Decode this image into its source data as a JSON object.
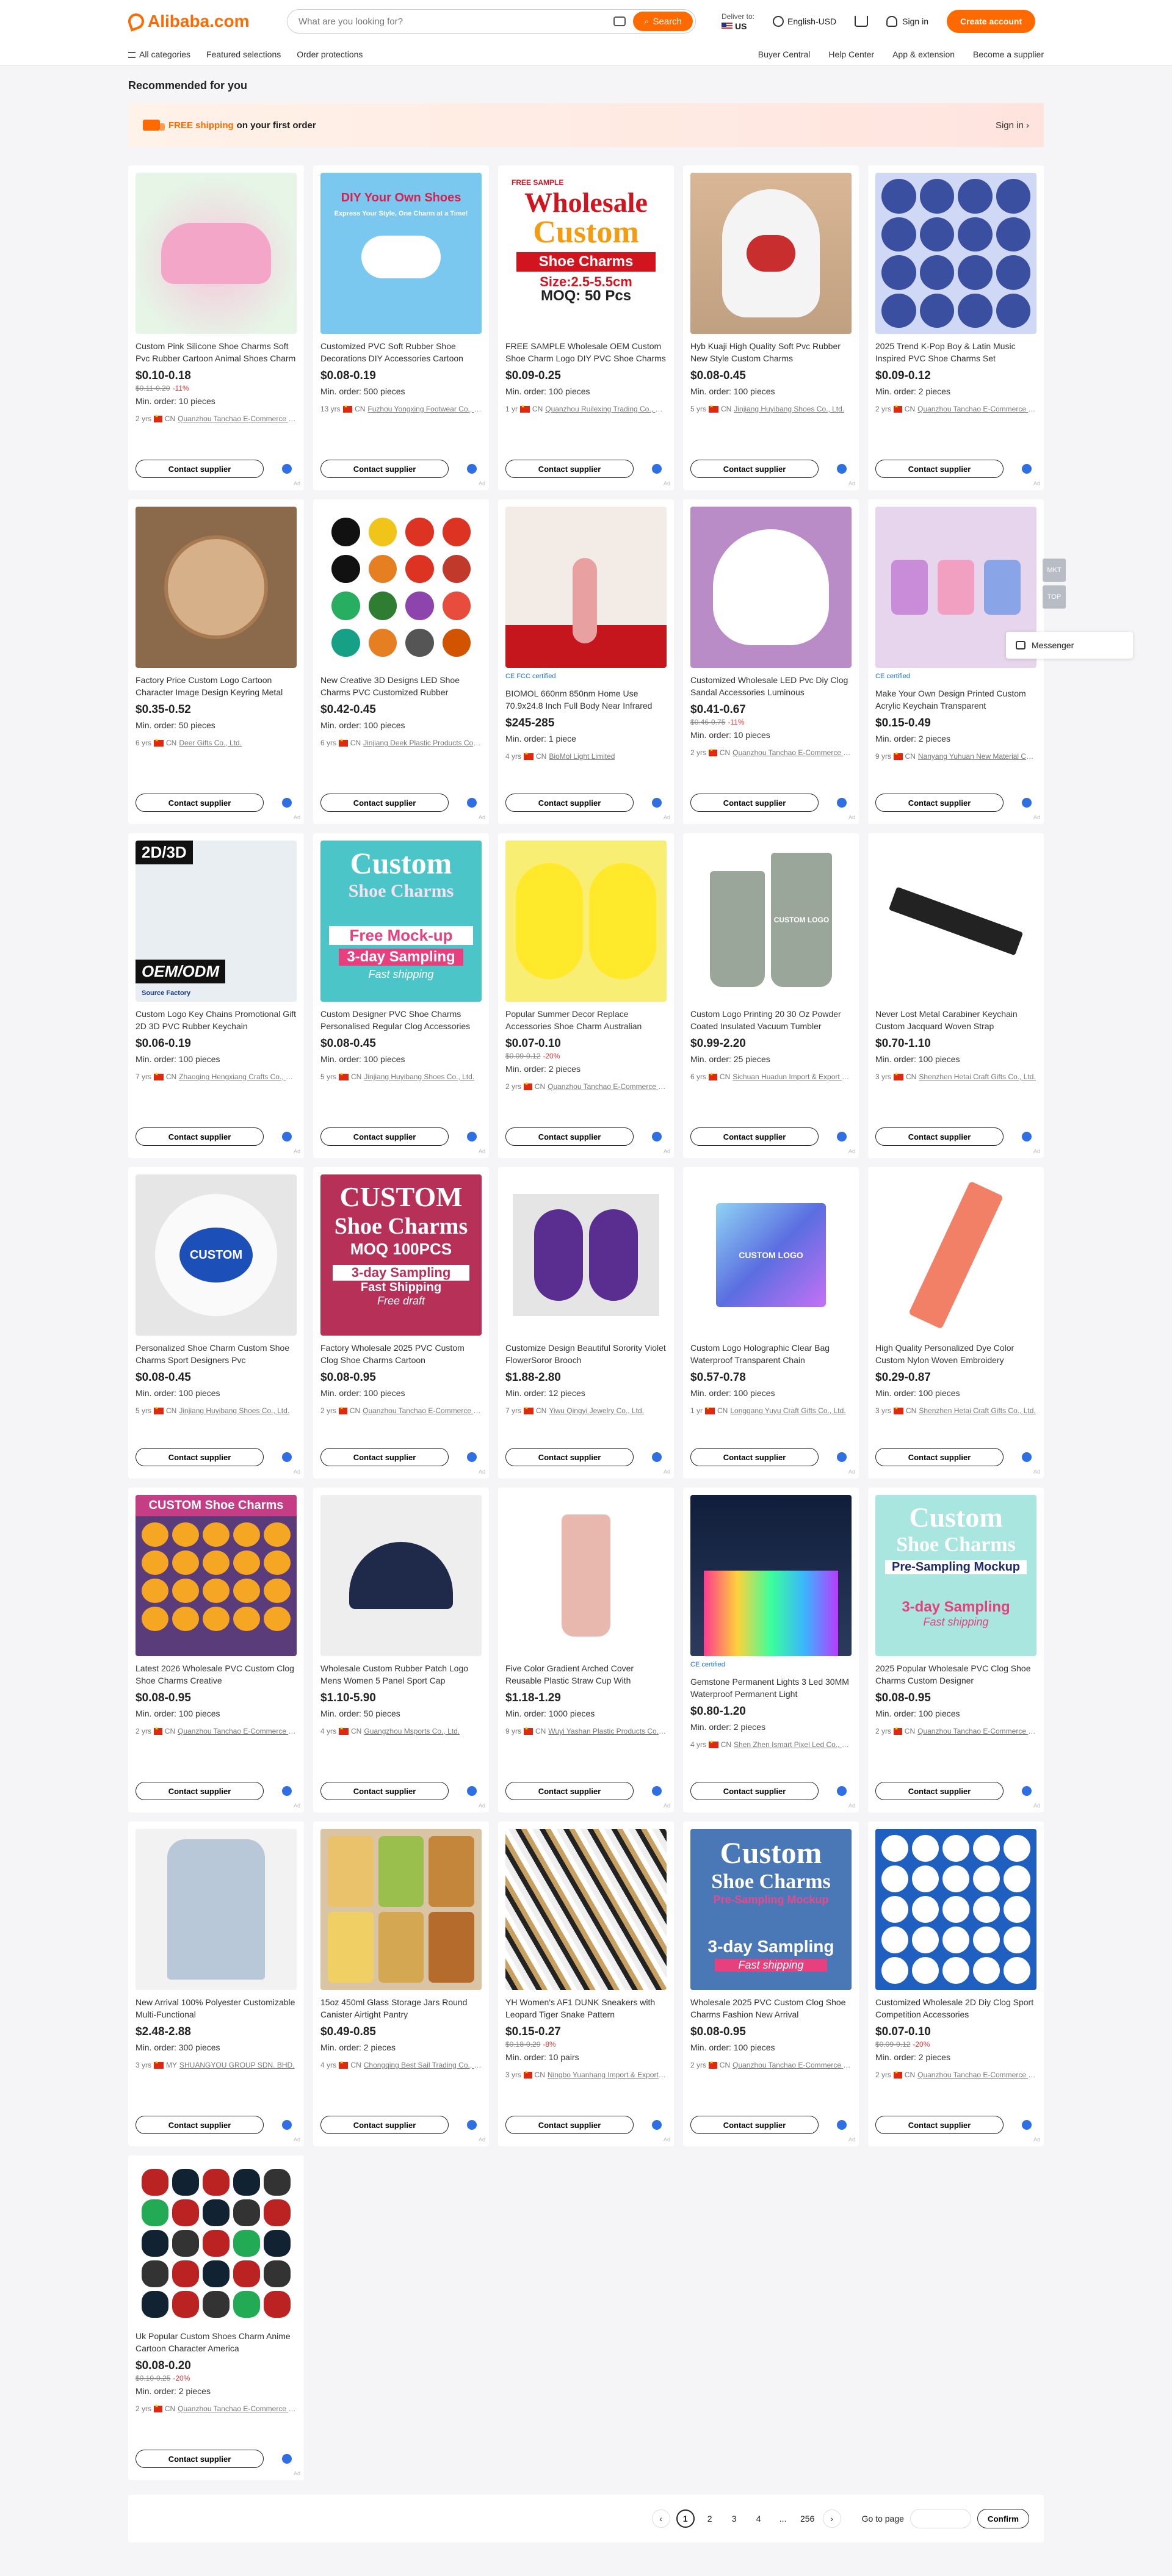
{
  "header": {
    "logo": "Alibaba.com",
    "search_placeholder": "What are you looking for?",
    "search_button": "Search",
    "deliver_label": "Deliver to:",
    "deliver_value": "US",
    "language": "English-USD",
    "sign_in": "Sign in",
    "create_account": "Create account"
  },
  "nav": {
    "left": [
      "All categories",
      "Featured selections",
      "Order protections"
    ],
    "right": [
      "Buyer Central",
      "Help Center",
      "App & extension",
      "Become a supplier"
    ]
  },
  "section_title": "Recommended for you",
  "promo": {
    "free": "FREE shipping",
    "rest": "on your first order",
    "sign_in": "Sign in ›"
  },
  "side_tools": [
    "MKT",
    "TOP"
  ],
  "messenger": "Messenger",
  "contact_label": "Contact supplier",
  "products": [
    {
      "title": "Custom Pink Silicone Shoe Charms Soft Pvc Rubber Cartoon Animal Shoes Charm",
      "price": "$0.10-0.18",
      "orig": "$0.11-0.20",
      "disc": "-11%",
      "moq": "Min. order: 10 pieces",
      "yrs": "2 yrs",
      "country": "CN",
      "supplier": "Quanzhou Tanchao E-Commerce Co., Ltd.",
      "cert": "",
      "art": "pink"
    },
    {
      "title": "Customized PVC Soft Rubber Shoe Decorations DIY Accessories Cartoon",
      "price": "$0.08-0.19",
      "orig": "",
      "disc": "",
      "moq": "Min. order: 500 pieces",
      "yrs": "13 yrs",
      "country": "CN",
      "supplier": "Fuzhou Yongxing Footwear Co., Ltd.",
      "cert": "",
      "art": "diy",
      "art_text": "DIY Your Own Shoes",
      "art_sub": "Express Your Style, One Charm at a Time!"
    },
    {
      "title": "FREE SAMPLE Wholesale OEM Custom Shoe Charm Logo DIY PVC Shoe Charms",
      "price": "$0.09-0.25",
      "orig": "",
      "disc": "",
      "moq": "Min. order: 100 pieces",
      "yrs": "1 yr",
      "country": "CN",
      "supplier": "Quanzhou Ruilexing Trading Co., Ltd.",
      "cert": "",
      "art": "wholesale",
      "art_lines": [
        "FREE SAMPLE",
        "Wholesale",
        "Custom",
        "Shoe Charms",
        "Size:2.5-5.5cm",
        "MOQ: 50 Pcs"
      ]
    },
    {
      "title": "Hyb Kuaji High Quality Soft Pvc Rubber New Style Custom Charms",
      "price": "$0.08-0.45",
      "orig": "",
      "disc": "",
      "moq": "Min. order: 100 pieces",
      "yrs": "5 yrs",
      "country": "CN",
      "supplier": "Jinjiang Huyibang Shoes Co., Ltd.",
      "cert": "",
      "art": "clog-white"
    },
    {
      "title": "2025 Trend K-Pop Boy & Latin Music Inspired PVC Shoe Charms Set",
      "price": "$0.09-0.12",
      "orig": "",
      "disc": "",
      "moq": "Min. order: 2 pieces",
      "yrs": "2 yrs",
      "country": "CN",
      "supplier": "Quanzhou Tanchao E-Commerce Co., Ltd.",
      "cert": "",
      "art": "kpop"
    },
    {
      "title": "Factory Price Custom Logo Cartoon Character Image Design Keyring Metal",
      "price": "$0.35-0.52",
      "orig": "",
      "disc": "",
      "moq": "Min. order: 50 pieces",
      "yrs": "6 yrs",
      "country": "CN",
      "supplier": "Deer Gifts Co., Ltd.",
      "cert": "",
      "art": "keyring"
    },
    {
      "title": "New Creative 3D Designs LED Shoe Charms PVC Customized Rubber",
      "price": "$0.42-0.45",
      "orig": "",
      "disc": "",
      "moq": "Min. order: 100 pieces",
      "yrs": "6 yrs",
      "country": "CN",
      "supplier": "Jinjiang Deek Plastic Products Co., Ltd.",
      "cert": "",
      "art": "grid-charms"
    },
    {
      "title": "BIOMOL 660nm 850nm Home Use 70.9x24.8 Inch Full Body Near Infrared",
      "price": "$245-285",
      "orig": "",
      "disc": "",
      "moq": "Min. order: 1 piece",
      "yrs": "4 yrs",
      "country": "CN",
      "supplier": "BioMol Light Limited",
      "cert": "CE FCC certified",
      "art": "yoga"
    },
    {
      "title": "Customized Wholesale LED Pvc Diy Clog Sandal Accessories Luminous",
      "price": "$0.41-0.67",
      "orig": "$0.46-0.75",
      "disc": "-11%",
      "moq": "Min. order: 10 pieces",
      "yrs": "2 yrs",
      "country": "CN",
      "supplier": "Quanzhou Tanchao E-Commerce Co., Ltd.",
      "cert": "",
      "art": "clog-pink"
    },
    {
      "title": "Make Your Own Design Printed Custom Acrylic Keychain Transparent",
      "price": "$0.15-0.49",
      "orig": "",
      "disc": "",
      "moq": "Min. order: 2 pieces",
      "yrs": "9 yrs",
      "country": "CN",
      "supplier": "Nanyang Yuhuan New Material Co., Ltd.",
      "cert": "CE certified",
      "art": "acrylic"
    },
    {
      "title": "Custom Logo Key Chains Promotional Gift 2D 3D PVC Rubber Keychain",
      "price": "$0.06-0.19",
      "orig": "",
      "disc": "",
      "moq": "Min. order: 100 pieces",
      "yrs": "7 yrs",
      "country": "CN",
      "supplier": "Zhaoqing Hengxiang Crafts Co., Ltd.",
      "cert": "",
      "art": "oem",
      "art_lines": [
        "2D/3D",
        "OEM/ODM",
        "Source Factory"
      ]
    },
    {
      "title": "Custom Designer PVC Shoe Charms Personalised Regular Clog Accessories",
      "price": "$0.08-0.45",
      "orig": "",
      "disc": "",
      "moq": "Min. order: 100 pieces",
      "yrs": "5 yrs",
      "country": "CN",
      "supplier": "Jinjiang Huyibang Shoes Co., Ltd.",
      "cert": "",
      "art": "custom-teal",
      "art_lines": [
        "Custom",
        "Shoe Charms",
        "Free Mock-up",
        "3-day Sampling",
        "Fast shipping"
      ]
    },
    {
      "title": "Popular Summer Decor Replace Accessories Shoe Charm Australian Animal",
      "price": "$0.07-0.10",
      "orig": "$0.09-0.12",
      "disc": "-20%",
      "moq": "Min. order: 2 pieces",
      "yrs": "2 yrs",
      "country": "CN",
      "supplier": "Quanzhou Tanchao E-Commerce Co., Ltd.",
      "cert": "",
      "art": "clog-yellow"
    },
    {
      "title": "Custom Logo Printing 20 30 Oz Powder Coated Insulated Vacuum Tumbler",
      "price": "$0.99-2.20",
      "orig": "",
      "disc": "",
      "moq": "Min. order: 25 pieces",
      "yrs": "6 yrs",
      "country": "CN",
      "supplier": "Sichuan Huadun Import & Export Co., Ltd.",
      "cert": "",
      "art": "tumbler",
      "art_text": "CUSTOM LOGO"
    },
    {
      "title": "Never Lost Metal Carabiner Keychain Custom Jacquard Woven Strap",
      "price": "$0.70-1.10",
      "orig": "",
      "disc": "",
      "moq": "Min. order: 100 pieces",
      "yrs": "3 yrs",
      "country": "CN",
      "supplier": "Shenzhen Hetai Craft Gifts Co., Ltd.",
      "cert": "",
      "art": "strap"
    },
    {
      "title": "Personalized Shoe Charm Custom Shoe Charms Sport Designers Pvc",
      "price": "$0.08-0.45",
      "orig": "",
      "disc": "",
      "moq": "Min. order: 100 pieces",
      "yrs": "5 yrs",
      "country": "CN",
      "supplier": "Jinjiang Huyibang Shoes Co., Ltd.",
      "cert": "",
      "art": "clog-blue",
      "art_text": "CUSTOM"
    },
    {
      "title": "Factory Wholesale 2025 PVC Custom Clog Shoe Charms Cartoon",
      "price": "$0.08-0.95",
      "orig": "",
      "disc": "",
      "moq": "Min. order: 100 pieces",
      "yrs": "2 yrs",
      "country": "CN",
      "supplier": "Quanzhou Tanchao E-Commerce Co., Ltd.",
      "cert": "",
      "art": "custom-pink",
      "art_lines": [
        "CUSTOM",
        "Shoe Charms",
        "MOQ 100PCS",
        "3-day Sampling",
        "Fast Shipping",
        "Free draft"
      ]
    },
    {
      "title": "Customize Design Beautiful Sorority Violet FlowerSoror Brooch",
      "price": "$1.88-2.80",
      "orig": "",
      "disc": "",
      "moq": "Min. order: 12 pieces",
      "yrs": "7 yrs",
      "country": "CN",
      "supplier": "Yiwu Qingyi Jewelry Co., Ltd.",
      "cert": "",
      "art": "brooch"
    },
    {
      "title": "Custom Logo Holographic Clear Bag Waterproof Transparent Chain",
      "price": "$0.57-0.78",
      "orig": "",
      "disc": "",
      "moq": "Min. order: 100 pieces",
      "yrs": "1 yr",
      "country": "CN",
      "supplier": "Longgang Yuyu Craft Gifts Co., Ltd.",
      "cert": "",
      "art": "bag",
      "art_text": "CUSTOM LOGO"
    },
    {
      "title": "High Quality Personalized Dye Color Custom Nylon Woven Embroidery",
      "price": "$0.29-0.87",
      "orig": "",
      "disc": "",
      "moq": "Min. order: 100 pieces",
      "yrs": "3 yrs",
      "country": "CN",
      "supplier": "Shenzhen Hetai Craft Gifts Co., Ltd.",
      "cert": "",
      "art": "lanyard"
    },
    {
      "title": "Latest 2026 Wholesale PVC Custom Clog Shoe Charms Creative",
      "price": "$0.08-0.95",
      "orig": "",
      "disc": "",
      "moq": "Min. order: 100 pieces",
      "yrs": "2 yrs",
      "country": "CN",
      "supplier": "Quanzhou Tanchao E-Commerce Co., Ltd.",
      "cert": "",
      "art": "charm-collage",
      "art_text": "CUSTOM Shoe Charms"
    },
    {
      "title": "Wholesale Custom Rubber Patch Logo Mens Women 5 Panel Sport Cap",
      "price": "$1.10-5.90",
      "orig": "",
      "disc": "",
      "moq": "Min. order: 50 pieces",
      "yrs": "4 yrs",
      "country": "CN",
      "supplier": "Guangzhou Msports Co., Ltd.",
      "cert": "",
      "art": "cap"
    },
    {
      "title": "Five Color Gradient Arched Cover Reusable Plastic Straw Cup With",
      "price": "$1.18-1.29",
      "orig": "",
      "disc": "",
      "moq": "Min. order: 1000 pieces",
      "yrs": "9 yrs",
      "country": "CN",
      "supplier": "Wuyi Yashan Plastic Products Co., Ltd.",
      "cert": "",
      "art": "cup"
    },
    {
      "title": "Gemstone Permanent Lights 3 Led 30MM Waterproof Permanent Light",
      "price": "$0.80-1.20",
      "orig": "",
      "disc": "",
      "moq": "Min. order: 2 pieces",
      "yrs": "4 yrs",
      "country": "CN",
      "supplier": "Shen Zhen Ismart Pixel Led Co., Ltd.",
      "cert": "CE certified",
      "art": "house"
    },
    {
      "title": "2025 Popular Wholesale PVC Clog Shoe Charms Custom Designer",
      "price": "$0.08-0.95",
      "orig": "",
      "disc": "",
      "moq": "Min. order: 100 pieces",
      "yrs": "2 yrs",
      "country": "CN",
      "supplier": "Quanzhou Tanchao E-Commerce Co., Ltd.",
      "cert": "",
      "art": "custom-mint",
      "art_lines": [
        "Custom",
        "Shoe Charms",
        "Pre-Sampling Mockup",
        "3-day Sampling",
        "Fast shipping"
      ]
    },
    {
      "title": "New Arrival 100% Polyester Customizable Multi-Functional",
      "price": "$2.48-2.88",
      "orig": "",
      "disc": "",
      "moq": "Min. order: 300 pieces",
      "yrs": "3 yrs",
      "country": "MY",
      "supplier": "SHUANGYOU GROUP SDN. BHD.",
      "cert": "",
      "art": "jacket"
    },
    {
      "title": "15oz 450ml Glass Storage Jars Round Canister Airtight Pantry",
      "price": "$0.49-0.85",
      "orig": "",
      "disc": "",
      "moq": "Min. order: 2 pieces",
      "yrs": "4 yrs",
      "country": "CN",
      "supplier": "Chongqing Best Sail Trading Co., Ltd.",
      "cert": "",
      "art": "jars"
    },
    {
      "title": "YH Women's AF1 DUNK Sneakers with Leopard Tiger Snake Pattern",
      "price": "$0.15-0.27",
      "orig": "$0.18-0.29",
      "disc": "-8%",
      "moq": "Min. order: 10 pairs",
      "yrs": "3 yrs",
      "country": "CN",
      "supplier": "Ningbo Yuanhang Import & Export Co., Ltd.",
      "cert": "",
      "art": "laces"
    },
    {
      "title": "Wholesale 2025 PVC Custom Clog Shoe Charms Fashion New Arrival",
      "price": "$0.08-0.95",
      "orig": "",
      "disc": "",
      "moq": "Min. order: 100 pieces",
      "yrs": "2 yrs",
      "country": "CN",
      "supplier": "Quanzhou Tanchao E-Commerce Co., Ltd.",
      "cert": "",
      "art": "custom-blue",
      "art_lines": [
        "Custom",
        "Shoe Charms",
        "Pre-Sampling Mockup",
        "3-day Sampling",
        "Fast shipping"
      ]
    },
    {
      "title": "Customized Wholesale 2D Diy Clog Sport Competition Accessories",
      "price": "$0.07-0.10",
      "orig": "$0.09-0.12",
      "disc": "-20%",
      "moq": "Min. order: 2 pieces",
      "yrs": "2 yrs",
      "country": "CN",
      "supplier": "Quanzhou Tanchao E-Commerce Co., Ltd.",
      "cert": "",
      "art": "sport-grid"
    },
    {
      "title": "Uk Popular Custom Shoes Charm Anime Cartoon Character America",
      "price": "$0.08-0.20",
      "orig": "$0.10-0.25",
      "disc": "-20%",
      "moq": "Min. order: 2 pieces",
      "yrs": "2 yrs",
      "country": "CN",
      "supplier": "Quanzhou Tanchao E-Commerce Co., Ltd.",
      "cert": "",
      "art": "usa"
    }
  ],
  "pagination": {
    "pages": [
      "1",
      "2",
      "3",
      "4",
      "...",
      "256"
    ],
    "current": "1",
    "goto_label": "Go to page",
    "confirm": "Confirm"
  }
}
